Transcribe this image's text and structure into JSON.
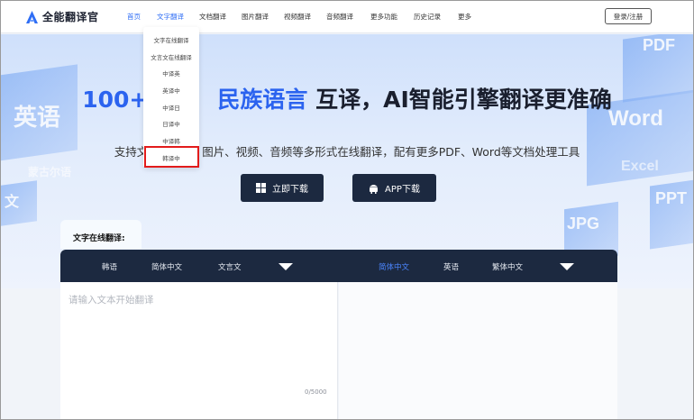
{
  "app": {
    "name": "全能翻译官"
  },
  "nav": {
    "items": [
      "首页",
      "文字翻译",
      "文档翻译",
      "图片翻译",
      "视频翻译",
      "音频翻译",
      "更多功能",
      "历史记录",
      "更多"
    ],
    "active_index": 1,
    "login_label": "登录/注册"
  },
  "dropdown": {
    "items": [
      "文字在线翻译",
      "文言文在线翻译",
      "中译英",
      "英译中",
      "中译日",
      "日译中",
      "中译韩",
      "韩译中"
    ],
    "highlighted_index": 7
  },
  "hero": {
    "title_part1": "100+外",
    "title_part2": "民族语言",
    "title_part3": "互译，AI智能引擎翻译更准确",
    "subtitle_left": "支持文",
    "subtitle_right": "图片、视频、音频等多形式在线翻译，配有更多PDF、Word等文档处理工具",
    "download_label": "立即下载",
    "app_download_label": "APP下载",
    "decor": [
      "英语",
      "蒙古尔语",
      "文",
      "PDF",
      "Word",
      "Excel",
      "PPT",
      "JPG"
    ]
  },
  "translator": {
    "section_label": "文字在线翻译:",
    "source_langs": [
      "韩语",
      "简体中文",
      "文言文"
    ],
    "target_langs": [
      "简体中文",
      "英语",
      "繁体中文"
    ],
    "target_active_index": 0,
    "input_placeholder": "请输入文本开始翻译",
    "char_count": "0/5000"
  },
  "colors": {
    "accent": "#2f6ef5",
    "dark_bar": "#1c2940",
    "highlight_border": "#e21b1b"
  },
  "icons": [
    "logo-icon",
    "windows-icon",
    "android-icon",
    "caret-down-icon"
  ]
}
